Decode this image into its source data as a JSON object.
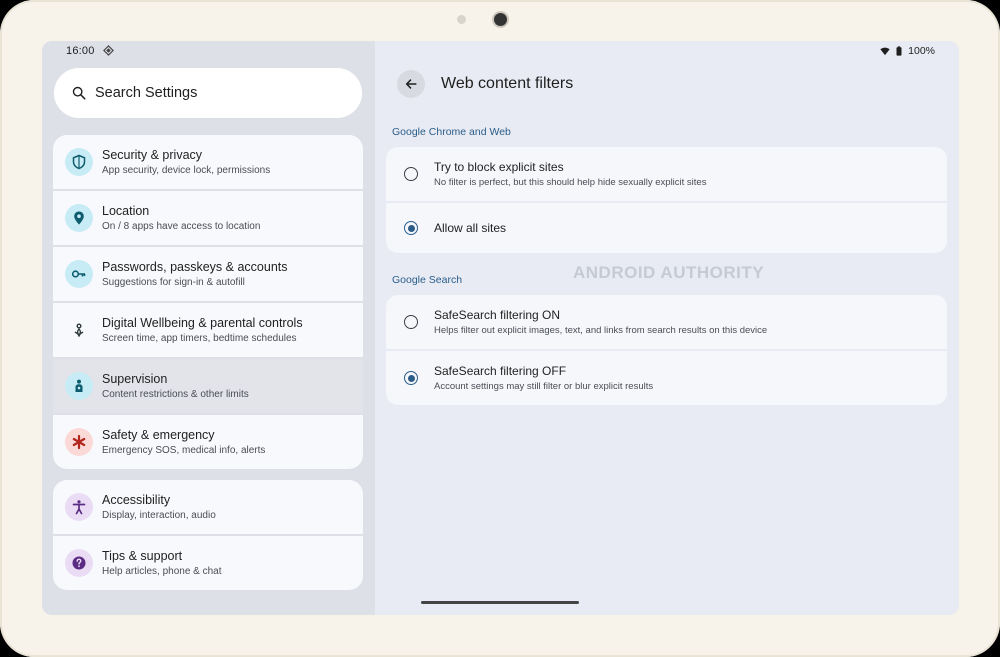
{
  "status": {
    "time": "16:00",
    "battery": "100%"
  },
  "search": {
    "placeholder": "Search Settings"
  },
  "sidebar": {
    "groups": [
      [
        {
          "title": "Security & privacy",
          "subtitle": "App security, device lock, permissions",
          "icon": "shield-icon",
          "color": "#c7ecf5",
          "fg": "#0e5d6f"
        },
        {
          "title": "Location",
          "subtitle": "On / 8 apps have access to location",
          "icon": "location-pin-icon",
          "color": "#c7ecf5",
          "fg": "#0e5d6f"
        },
        {
          "title": "Passwords, passkeys & accounts",
          "subtitle": "Suggestions for sign-in & autofill",
          "icon": "key-icon",
          "color": "#c7ecf5",
          "fg": "#0e5d6f"
        },
        {
          "title": "Digital Wellbeing & parental controls",
          "subtitle": "Screen time, app timers, bedtime schedules",
          "icon": "wellbeing-icon",
          "color": "#f8f9fc",
          "fg": "#2f3b3a"
        },
        {
          "title": "Supervision",
          "subtitle": "Content restrictions & other limits",
          "icon": "supervision-icon",
          "color": "#c7ecf5",
          "fg": "#0e5d6f",
          "selected": true
        },
        {
          "title": "Safety & emergency",
          "subtitle": "Emergency SOS, medical info, alerts",
          "icon": "asterisk-icon",
          "color": "#fbd9d7",
          "fg": "#b3261e"
        }
      ],
      [
        {
          "title": "Accessibility",
          "subtitle": "Display, interaction, audio",
          "icon": "accessibility-icon",
          "color": "#eadcf5",
          "fg": "#5b2c83"
        },
        {
          "title": "Tips & support",
          "subtitle": "Help articles, phone & chat",
          "icon": "help-icon",
          "color": "#eadcf5",
          "fg": "#5b2c83"
        }
      ]
    ]
  },
  "detail": {
    "title": "Web content filters",
    "sections": [
      {
        "label": "Google Chrome and Web",
        "options": [
          {
            "title": "Try to block explicit sites",
            "subtitle": "No filter is perfect, but this should help hide sexually explicit sites",
            "selected": false
          },
          {
            "title": "Allow all sites",
            "subtitle": "",
            "selected": true
          }
        ]
      },
      {
        "label": "Google Search",
        "options": [
          {
            "title": "SafeSearch filtering ON",
            "subtitle": "Helps filter out explicit images, text, and links from search results on this device",
            "selected": false
          },
          {
            "title": "SafeSearch filtering OFF",
            "subtitle": "Account settings may still filter or blur explicit results",
            "selected": true
          }
        ]
      }
    ]
  },
  "watermark": "ANDROID AUTHORITY",
  "colors": {
    "accent": "#2a5d8a",
    "bezel": "#f7f3ea"
  }
}
